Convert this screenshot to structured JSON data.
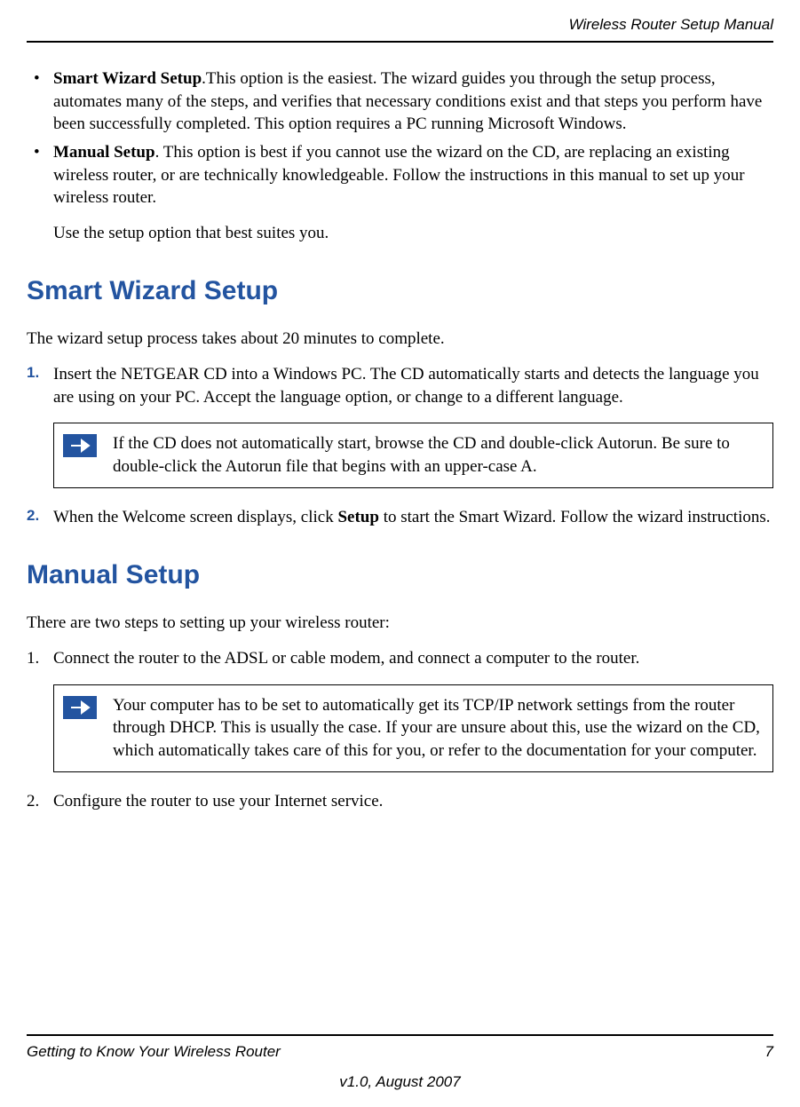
{
  "header": {
    "title": "Wireless Router Setup Manual"
  },
  "bullets": [
    {
      "bold": "Smart Wizard Setup",
      "rest": ".This option is the easiest. The wizard guides you through the setup process, automates many of the steps, and verifies that necessary conditions exist and that steps you perform have been successfully completed. This option requires a PC running Microsoft Windows."
    },
    {
      "bold": "Manual Setup",
      "rest": ". This option is best if you cannot use the wizard on the CD, are replacing an existing wireless router, or are technically knowledgeable. Follow the instructions in this manual to set up your wireless router."
    }
  ],
  "bullets_tail": "Use the setup option that best suites you.",
  "section1": {
    "heading": "Smart Wizard Setup",
    "intro": "The wizard setup process takes about 20 minutes to complete.",
    "steps": [
      {
        "num": "1.",
        "text": "Insert the NETGEAR CD into a Windows PC. The CD automatically starts and detects the language you are using on your PC. Accept the language option, or change to a different language."
      },
      {
        "num": "2.",
        "pre": "When the Welcome screen displays, click ",
        "bold": "Setup",
        "post": " to start the Smart Wizard. Follow the wizard instructions."
      }
    ],
    "note": "If the CD does not automatically start, browse the CD and double-click Autorun. Be sure to double-click the Autorun file that begins with an upper-case A."
  },
  "section2": {
    "heading": "Manual Setup",
    "intro": "There are two steps to setting up your wireless router:",
    "steps": [
      {
        "num": "1.",
        "text": "Connect the router to the ADSL or cable modem, and connect a computer to the router."
      },
      {
        "num": "2.",
        "text": "Configure the router to use your Internet service."
      }
    ],
    "note": "Your computer has to be set to automatically get its TCP/IP network settings from the router through DHCP. This is usually the case. If your are unsure about this, use the wizard on the CD, which automatically takes care of this for you, or refer to the documentation for your computer."
  },
  "footer": {
    "left": "Getting to Know Your Wireless Router",
    "right": "7",
    "center": "v1.0, August 2007"
  }
}
